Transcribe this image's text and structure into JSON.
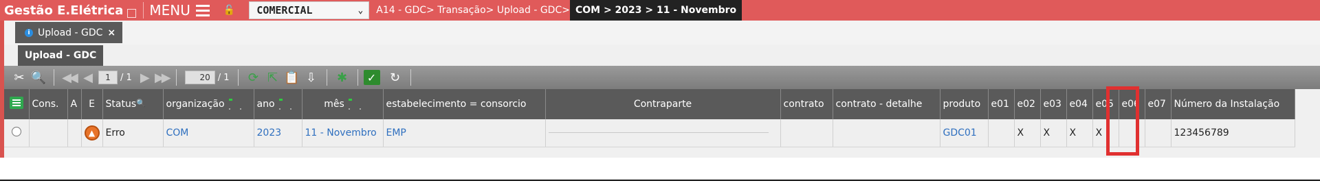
{
  "app": {
    "title": "Gestão E.Elétrica",
    "menu_label": "MENU",
    "company_select": "COMERCIAL",
    "breadcrumb": "A14 - GDC> Transação> Upload - GDC>",
    "breadcrumb_current": "COM > 2023 > 11 - Novembro"
  },
  "tabs": [
    {
      "label": "Upload - GDC",
      "close": "×"
    }
  ],
  "subtab": {
    "label": "Upload - GDC"
  },
  "toolbar": {
    "page_current": "1",
    "page_total": "/ 1",
    "rows_per_page": "20",
    "rows_total": "/ 1"
  },
  "table": {
    "columns": [
      "Cons.",
      "A",
      "E",
      "Status",
      "organização",
      "ano",
      "mês",
      "estabelecimento = consorcio",
      "Contraparte",
      "contrato",
      "contrato - detalhe",
      "produto",
      "e01",
      "e02",
      "e03",
      "e04",
      "e05",
      "e06",
      "e07",
      "Número da Instalação"
    ],
    "rows": [
      {
        "cons": "",
        "a": "",
        "status": "Erro",
        "organizacao": "COM",
        "ano": "2023",
        "mes": "11 - Novembro",
        "estabelecimento": "EMP",
        "contraparte": "",
        "contrato": "",
        "contrato_detalhe": "",
        "produto": "GDC01",
        "e01": "",
        "e02": "X",
        "e03": "X",
        "e04": "X",
        "e05": "X",
        "e06": "",
        "e07": "",
        "numero_instalacao": "123456789"
      }
    ]
  },
  "colors": {
    "top_bar": "#e05a5a",
    "header_bg": "#5a5a5a",
    "highlight": "#e03030",
    "link_blue": "#2e6fbf"
  }
}
